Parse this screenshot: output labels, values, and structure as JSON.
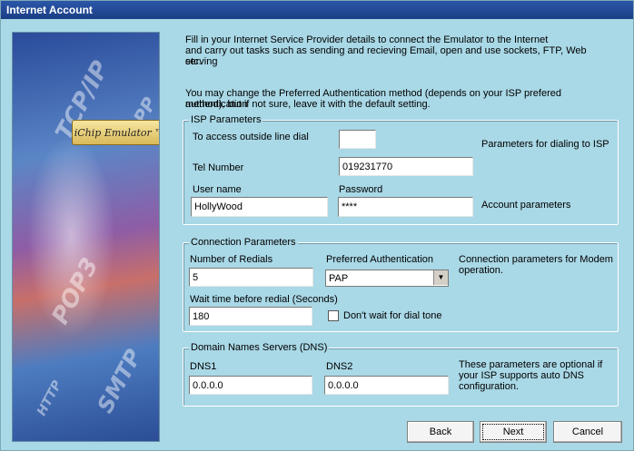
{
  "window": {
    "title": "Internet Account"
  },
  "banner": {
    "logo_text": "iChip Emulator ™",
    "watermarks": [
      "TCP/IP",
      "POP3",
      "SMTP",
      "HTTP",
      "PPP"
    ]
  },
  "intro": {
    "line1": "Fill in your Internet Service Provider details to connect the Emulator to the Internet",
    "line2": "and carry out tasks such as sending and recieving Email, open and use sockets, FTP, Web serving",
    "line3": "etc.",
    "line4": "You may change the Preferred Authentication method (depends on your ISP prefered authentication",
    "line5": "method), but if not sure, leave it with the default setting."
  },
  "isp": {
    "legend": "ISP Parameters",
    "outside_line_label": "To access outside line dial",
    "outside_line_value": "",
    "dial_note": "Parameters for dialing to ISP",
    "tel_label": "Tel Number",
    "tel_value": "019231770",
    "user_label": "User name",
    "user_value": "HollyWood",
    "password_label": "Password",
    "password_value": "****",
    "account_note": "Account parameters"
  },
  "conn": {
    "legend": "Connection Parameters",
    "redials_label": "Number of Redials",
    "redials_value": "5",
    "auth_label": "Preferred Authentication",
    "auth_value": "PAP",
    "note_line1": "Connection parameters for Modem",
    "note_line2": "operation.",
    "wait_label": "Wait time before redial (Seconds)",
    "wait_value": "180",
    "dialtone_label": "Don't wait for dial tone"
  },
  "dns": {
    "legend": "Domain Names Servers (DNS)",
    "dns1_label": "DNS1",
    "dns1_value": "0.0.0.0",
    "dns2_label": "DNS2",
    "dns2_value": "0.0.0.0",
    "note_line1": "These parameters are optional if",
    "note_line2": "your ISP supports auto DNS",
    "note_line3": "configuration."
  },
  "buttons": {
    "back": "Back",
    "next": "Next",
    "cancel": "Cancel"
  },
  "colors": {
    "window_bg": "#a9d8e6",
    "titlebar": "#1b3f86"
  }
}
